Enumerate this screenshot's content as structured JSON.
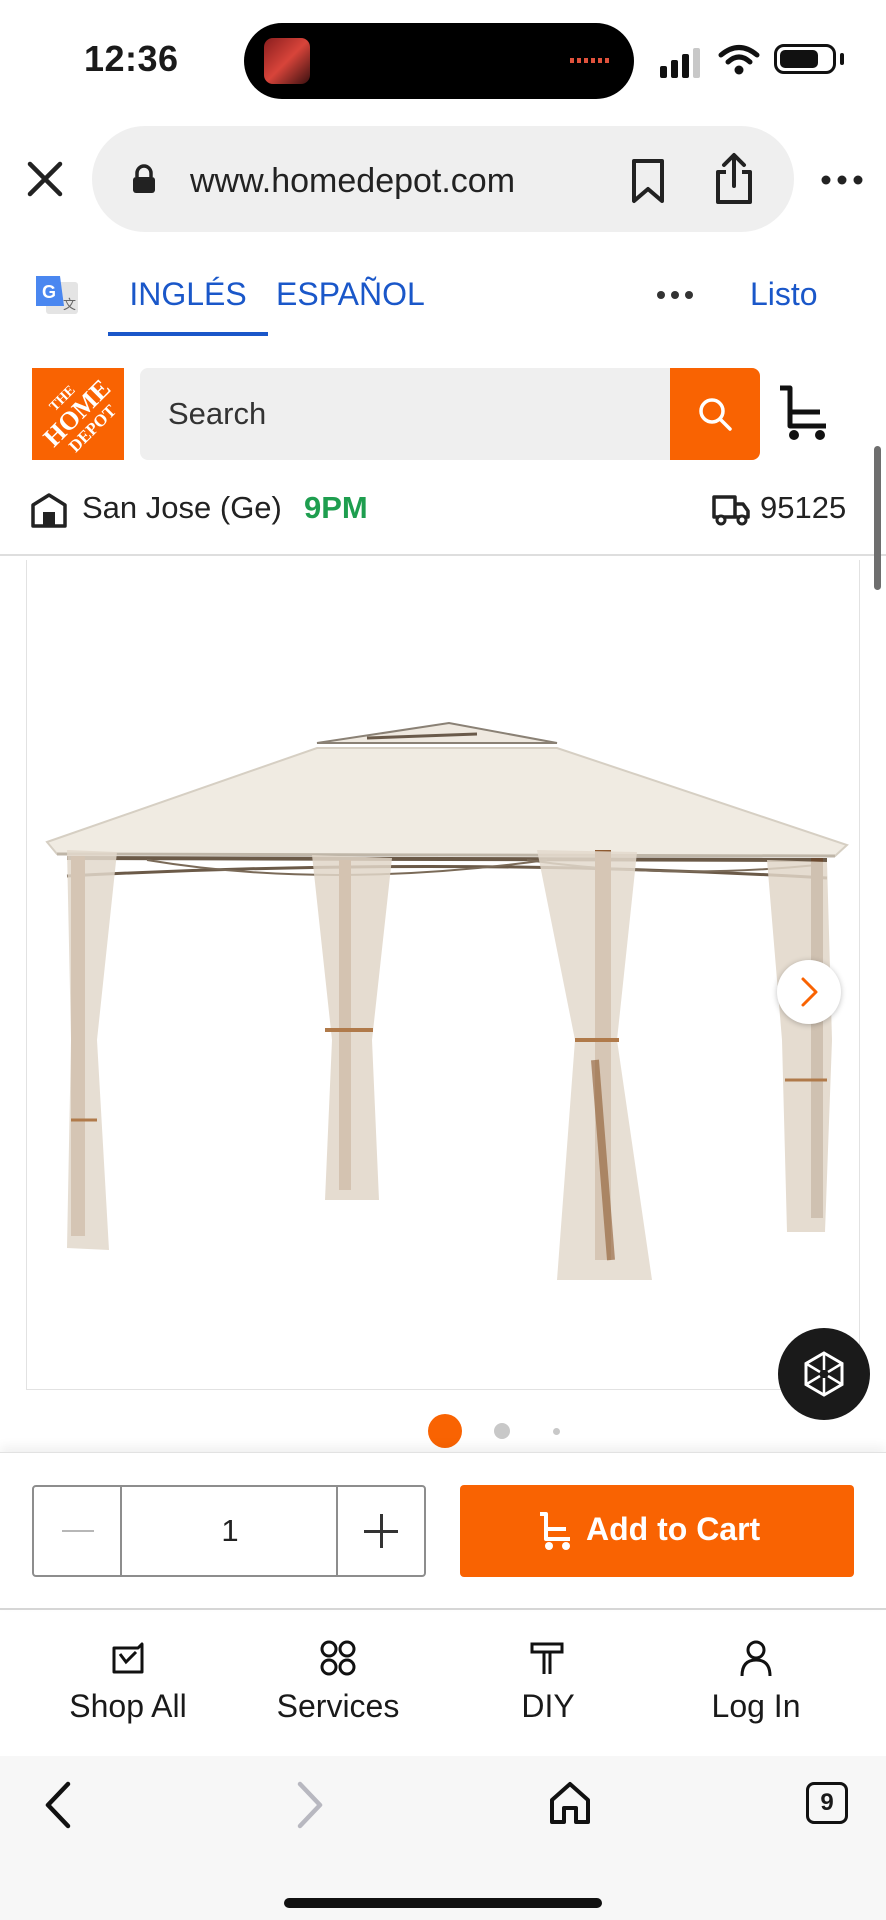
{
  "status_bar": {
    "time": "12:36"
  },
  "browser": {
    "url": "www.homedepot.com"
  },
  "translate_bar": {
    "tab_english": "INGLÉS",
    "tab_spanish": "ESPAÑOL",
    "done": "Listo"
  },
  "header": {
    "logo_lines": [
      "THE",
      "HOME",
      "DEPOT"
    ],
    "search_placeholder": "Search"
  },
  "store": {
    "name": "San Jose (Ge)",
    "closing_time": "9PM",
    "zip": "95125"
  },
  "carousel": {
    "image_count": 3,
    "active_index": 0
  },
  "purchase": {
    "quantity": "1",
    "add_to_cart": "Add to Cart"
  },
  "bottom_nav": {
    "items": [
      {
        "label": "Shop All",
        "icon": "shop-all-icon"
      },
      {
        "label": "Services",
        "icon": "services-icon"
      },
      {
        "label": "DIY",
        "icon": "diy-hammer-icon"
      },
      {
        "label": "Log In",
        "icon": "user-icon"
      }
    ]
  },
  "safari": {
    "tab_count": "9"
  },
  "colors": {
    "brand_orange": "#f96302",
    "link_blue": "#1a57c9",
    "open_green": "#1e9e4f"
  }
}
